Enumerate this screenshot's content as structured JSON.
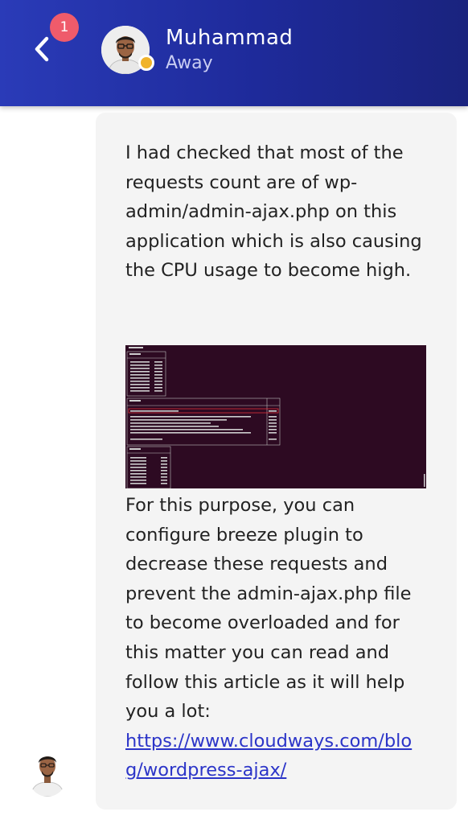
{
  "header": {
    "back_label": "Back",
    "unread_count": "1",
    "contact_name": "Muhammad",
    "contact_status": "Away",
    "status_color": "#f0b32b",
    "badge_color": "#ef5b6b"
  },
  "message": {
    "paragraph_1": "I had checked that most of the\nrequests count are of wp-\nadmin/admin-ajax.php on this\napplication which is also causing\nthe CPU usage to become high.",
    "paragraph_2": "For this purpose, you can\nconfigure breeze plugin to\ndecrease these requests and\nprevent the admin-ajax.php file\nto become overloaded and for\nthis matter you can read and\nfollow this article as it will help\nyou a lot:",
    "link_text": "https://www.cloudways.com/blo\ng/wordpress-ajax/",
    "link_href": "https://www.cloudways.com/blog/wordpress-ajax/",
    "attachment_alt": "terminal screenshot of top request URLs"
  },
  "icons": {
    "back": "chevron-left-icon",
    "status": "status-dot-icon"
  }
}
